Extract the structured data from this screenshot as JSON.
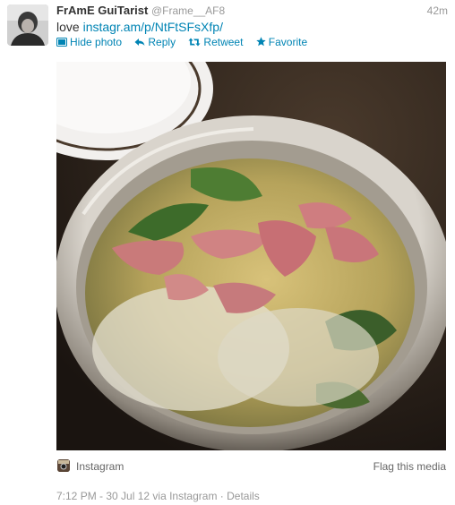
{
  "tweet": {
    "fullname": "FrAmE GuiTarist",
    "username": "@Frame__AF8",
    "timestamp": "42m",
    "text_prefix": "love ",
    "link": "instagr.am/p/NtFtSFsXfp/"
  },
  "actions": {
    "hide_photo": "Hide photo",
    "reply": "Reply",
    "retweet": "Retweet",
    "favorite": "Favorite"
  },
  "media": {
    "source_label": "Instagram",
    "flag_label": "Flag this media"
  },
  "meta": {
    "datetime": "7:12 PM - 30 Jul 12",
    "via": " via ",
    "source": "Instagram",
    "separator": " · ",
    "details": "Details"
  },
  "colors": {
    "link": "#0084b4",
    "muted": "#999999",
    "text": "#333333"
  }
}
